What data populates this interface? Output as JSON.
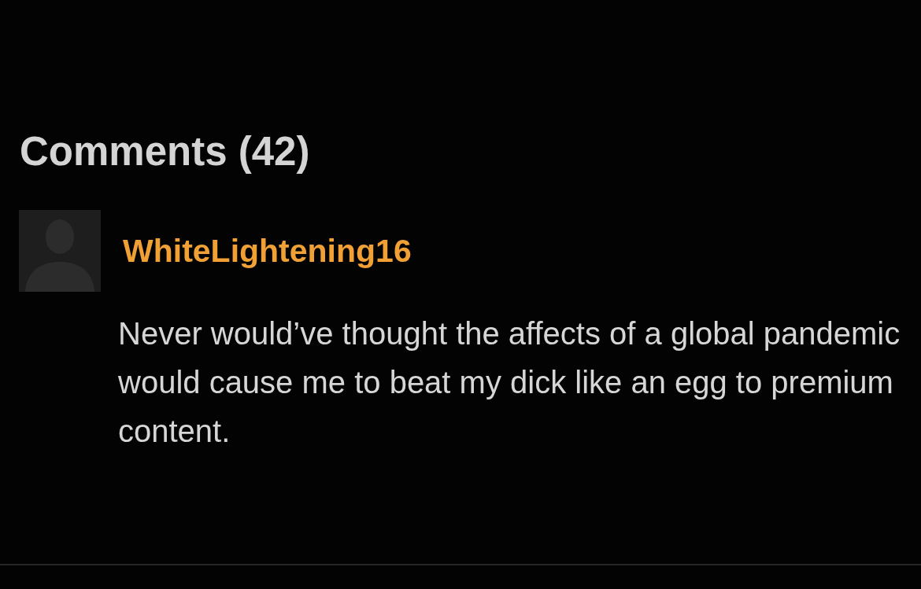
{
  "comments_section": {
    "title": "Comments (42)",
    "comments": [
      {
        "username": "WhiteLightening16",
        "text": "Never would’ve thought the affects of a global pandemic would cause me to beat my dick like an egg to premium content."
      }
    ]
  }
}
